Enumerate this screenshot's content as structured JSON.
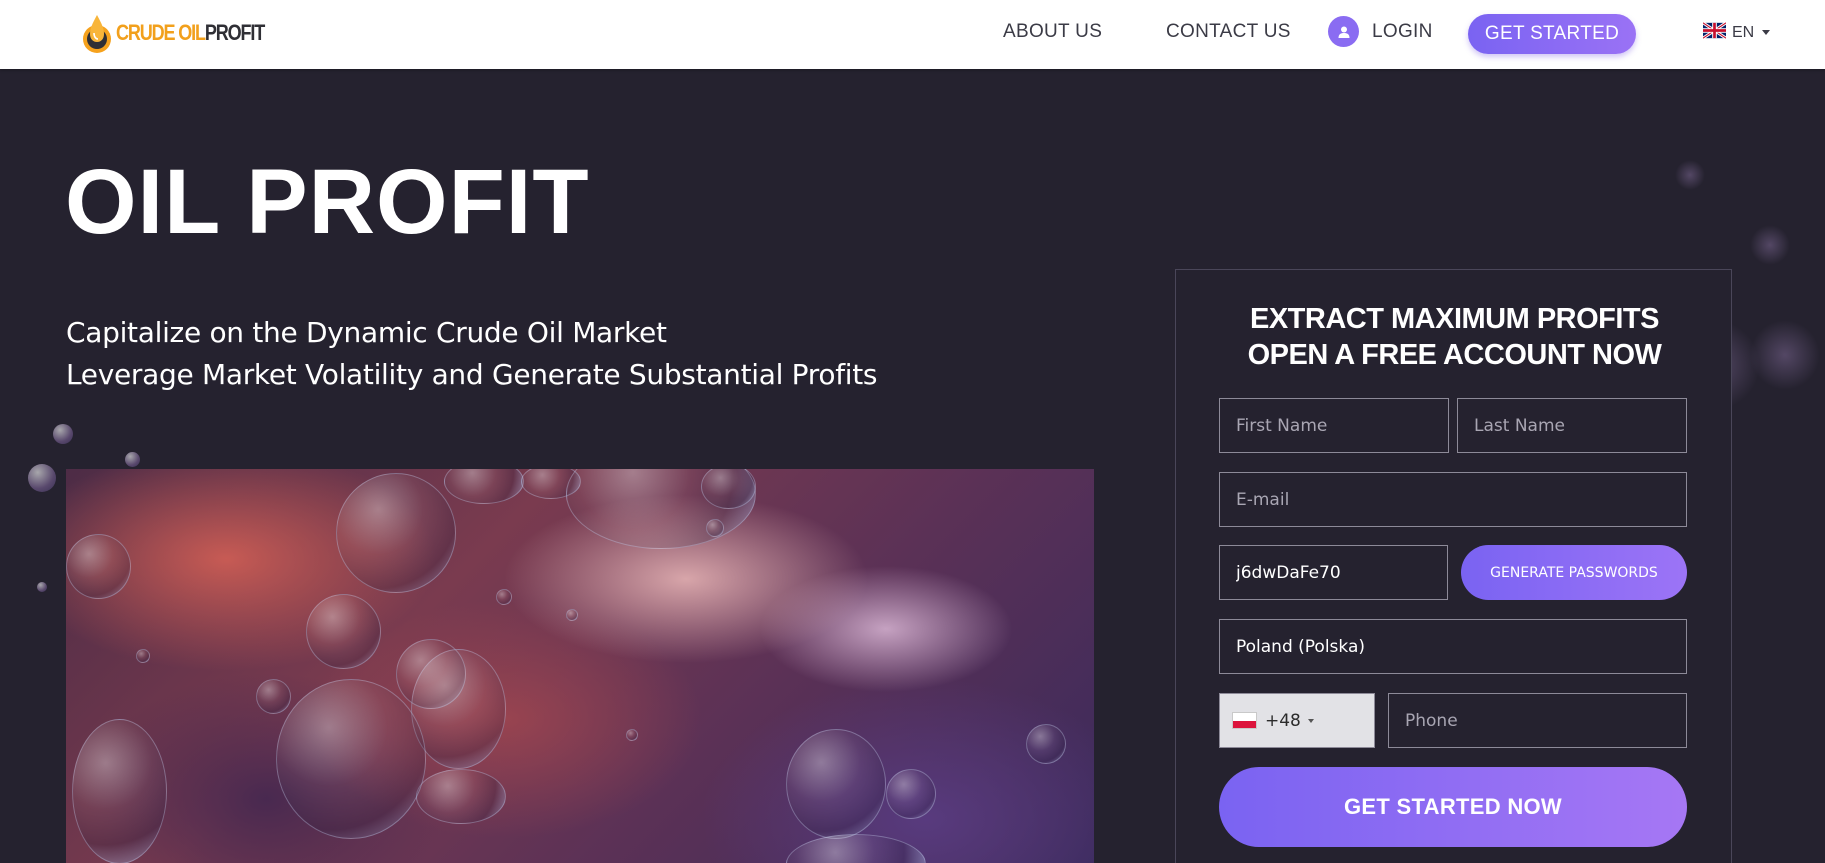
{
  "header": {
    "logo": {
      "part1": "CRUDE OIL",
      "part2": "PROFIT"
    },
    "nav": {
      "about": "ABOUT US",
      "contact": "CONTACT US",
      "login": "LOGIN",
      "get_started": "GET STARTED"
    },
    "language": {
      "label": "EN",
      "flag": "uk-flag-icon"
    }
  },
  "hero": {
    "title": "OIL PROFIT",
    "subtitle_line1": "Capitalize on the Dynamic Crude Oil Market",
    "subtitle_line2": "Leverage Market Volatility and Generate Substantial Profits"
  },
  "form": {
    "title_line1": "EXTRACT MAXIMUM PROFITS",
    "title_line2": "OPEN A FREE ACCOUNT NOW",
    "first_name_placeholder": "First Name",
    "last_name_placeholder": "Last Name",
    "email_placeholder": "E-mail",
    "password_value": "j6dwDaFe70",
    "generate_label": "GENERATE PASSWORDS",
    "country_value": "Poland (Polska)",
    "dial_code": "+48",
    "dial_flag": "poland-flag-icon",
    "phone_placeholder": "Phone",
    "submit_label": "GET STARTED NOW"
  },
  "colors": {
    "background": "#25222f",
    "accent": "#7a63f2",
    "accent_end": "#a677f4",
    "logo_orange": "#f2a01c"
  }
}
